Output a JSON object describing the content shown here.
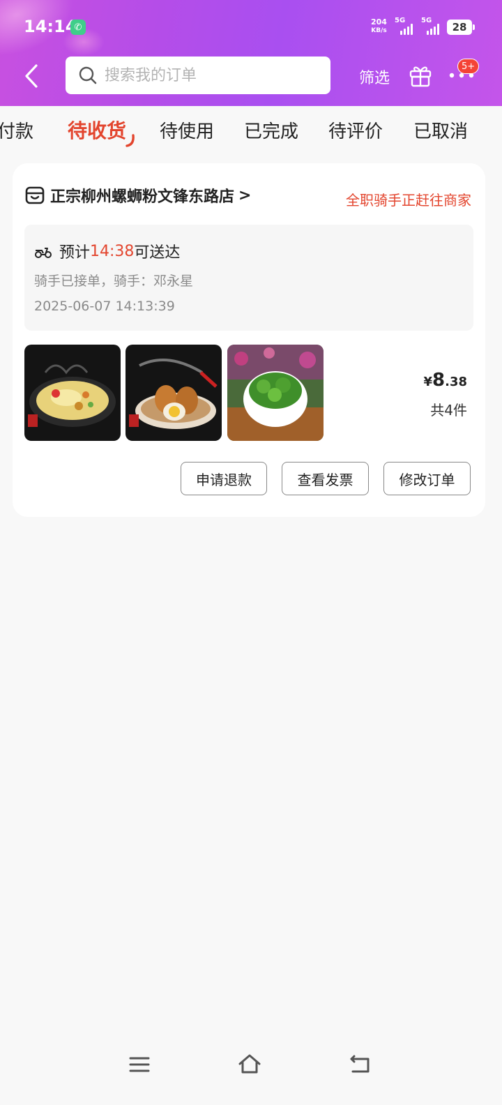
{
  "status_bar": {
    "time": "14:14",
    "net_speed_value": "204",
    "net_speed_unit": "KB/s",
    "sim1": "5G",
    "sim2": "5G",
    "battery": "28"
  },
  "header": {
    "search_placeholder": "搜索我的订单",
    "filter_label": "筛选",
    "more_badge": "5+"
  },
  "tabs": [
    {
      "label": "付款",
      "active": false
    },
    {
      "label": "待收货",
      "active": true
    },
    {
      "label": "待使用",
      "active": false
    },
    {
      "label": "已完成",
      "active": false
    },
    {
      "label": "待评价",
      "active": false
    },
    {
      "label": "已取消",
      "active": false
    }
  ],
  "order": {
    "shop_name": "正宗柳州螺蛳粉文锋东路店",
    "shop_arrow": ">",
    "rider_status": "全职骑手正赶往商家",
    "eta_prefix": "预计",
    "eta_time": "14:38",
    "eta_suffix": "可送达",
    "rider_info": "骑手已接单，骑手：邓永星",
    "order_time": "2025-06-07 14:13:39",
    "price_symbol": "¥",
    "price_int": "8",
    "price_dec": ".38",
    "item_count": "共4件",
    "buttons": {
      "refund": "申请退款",
      "invoice": "查看发票",
      "modify": "修改订单"
    },
    "accent_color": "#e3452e"
  }
}
